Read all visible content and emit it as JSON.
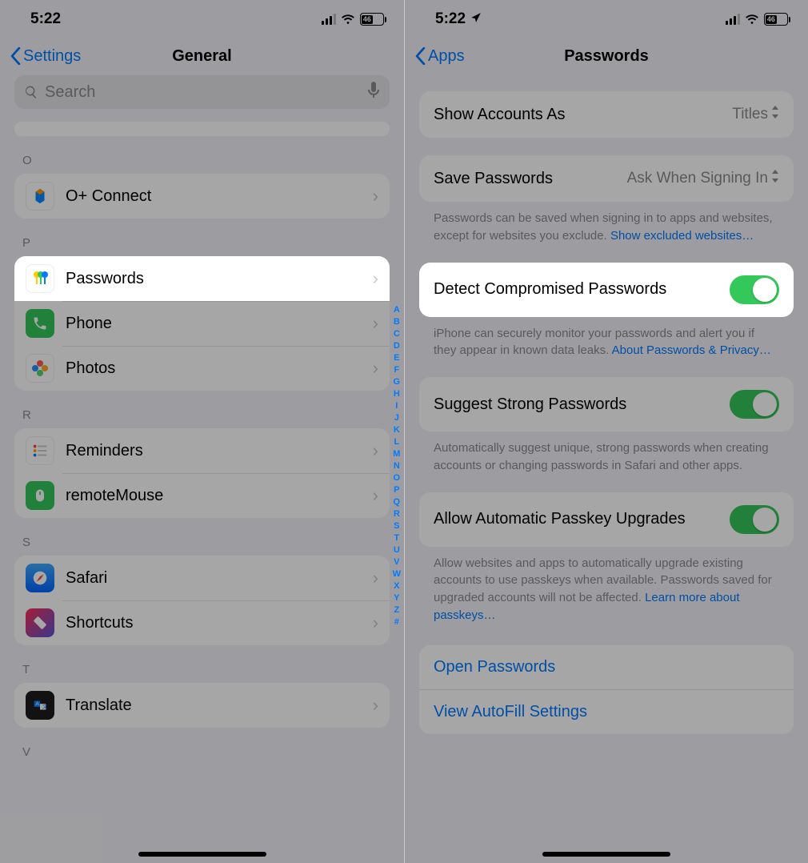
{
  "left": {
    "status": {
      "time": "5:22",
      "battery": "46"
    },
    "nav": {
      "back": "Settings",
      "title": "General"
    },
    "search_placeholder": "Search",
    "sections": {
      "o_header": "O",
      "o": {
        "connect": "O+ Connect"
      },
      "p_header": "P",
      "p": {
        "passwords": "Passwords",
        "phone": "Phone",
        "photos": "Photos"
      },
      "r_header": "R",
      "r": {
        "reminders": "Reminders",
        "remotemouse": "remoteMouse"
      },
      "s_header": "S",
      "s": {
        "safari": "Safari",
        "shortcuts": "Shortcuts"
      },
      "t_header": "T",
      "t": {
        "translate": "Translate"
      },
      "v_header": "V"
    },
    "index": [
      "A",
      "B",
      "C",
      "D",
      "E",
      "F",
      "G",
      "H",
      "I",
      "J",
      "K",
      "L",
      "M",
      "N",
      "O",
      "P",
      "Q",
      "R",
      "S",
      "T",
      "U",
      "V",
      "W",
      "X",
      "Y",
      "Z",
      "#"
    ]
  },
  "right": {
    "status": {
      "time": "5:22",
      "battery": "46"
    },
    "nav": {
      "back": "Apps",
      "title": "Passwords"
    },
    "show_accounts": {
      "label": "Show Accounts As",
      "value": "Titles"
    },
    "save_passwords": {
      "label": "Save Passwords",
      "value": "Ask When Signing In",
      "footer_a": "Passwords can be saved when signing in to apps and websites, except for websites you exclude. ",
      "footer_link": "Show excluded websites…"
    },
    "detect": {
      "label": "Detect Compromised Passwords",
      "footer_a": "iPhone can securely monitor your passwords and alert you if they appear in known data leaks. ",
      "footer_link": "About Passwords & Privacy…"
    },
    "suggest": {
      "label": "Suggest Strong Passwords",
      "footer": "Automatically suggest unique, strong passwords when creating accounts or changing passwords in Safari and other apps."
    },
    "passkeys": {
      "label": "Allow Automatic Passkey Upgrades",
      "footer_a": "Allow websites and apps to automatically upgrade existing accounts to use passkeys when available. Passwords saved for upgraded accounts will not be affected. ",
      "footer_link": "Learn more about passkeys…"
    },
    "open_passwords": "Open Passwords",
    "autofill": "View AutoFill Settings"
  }
}
